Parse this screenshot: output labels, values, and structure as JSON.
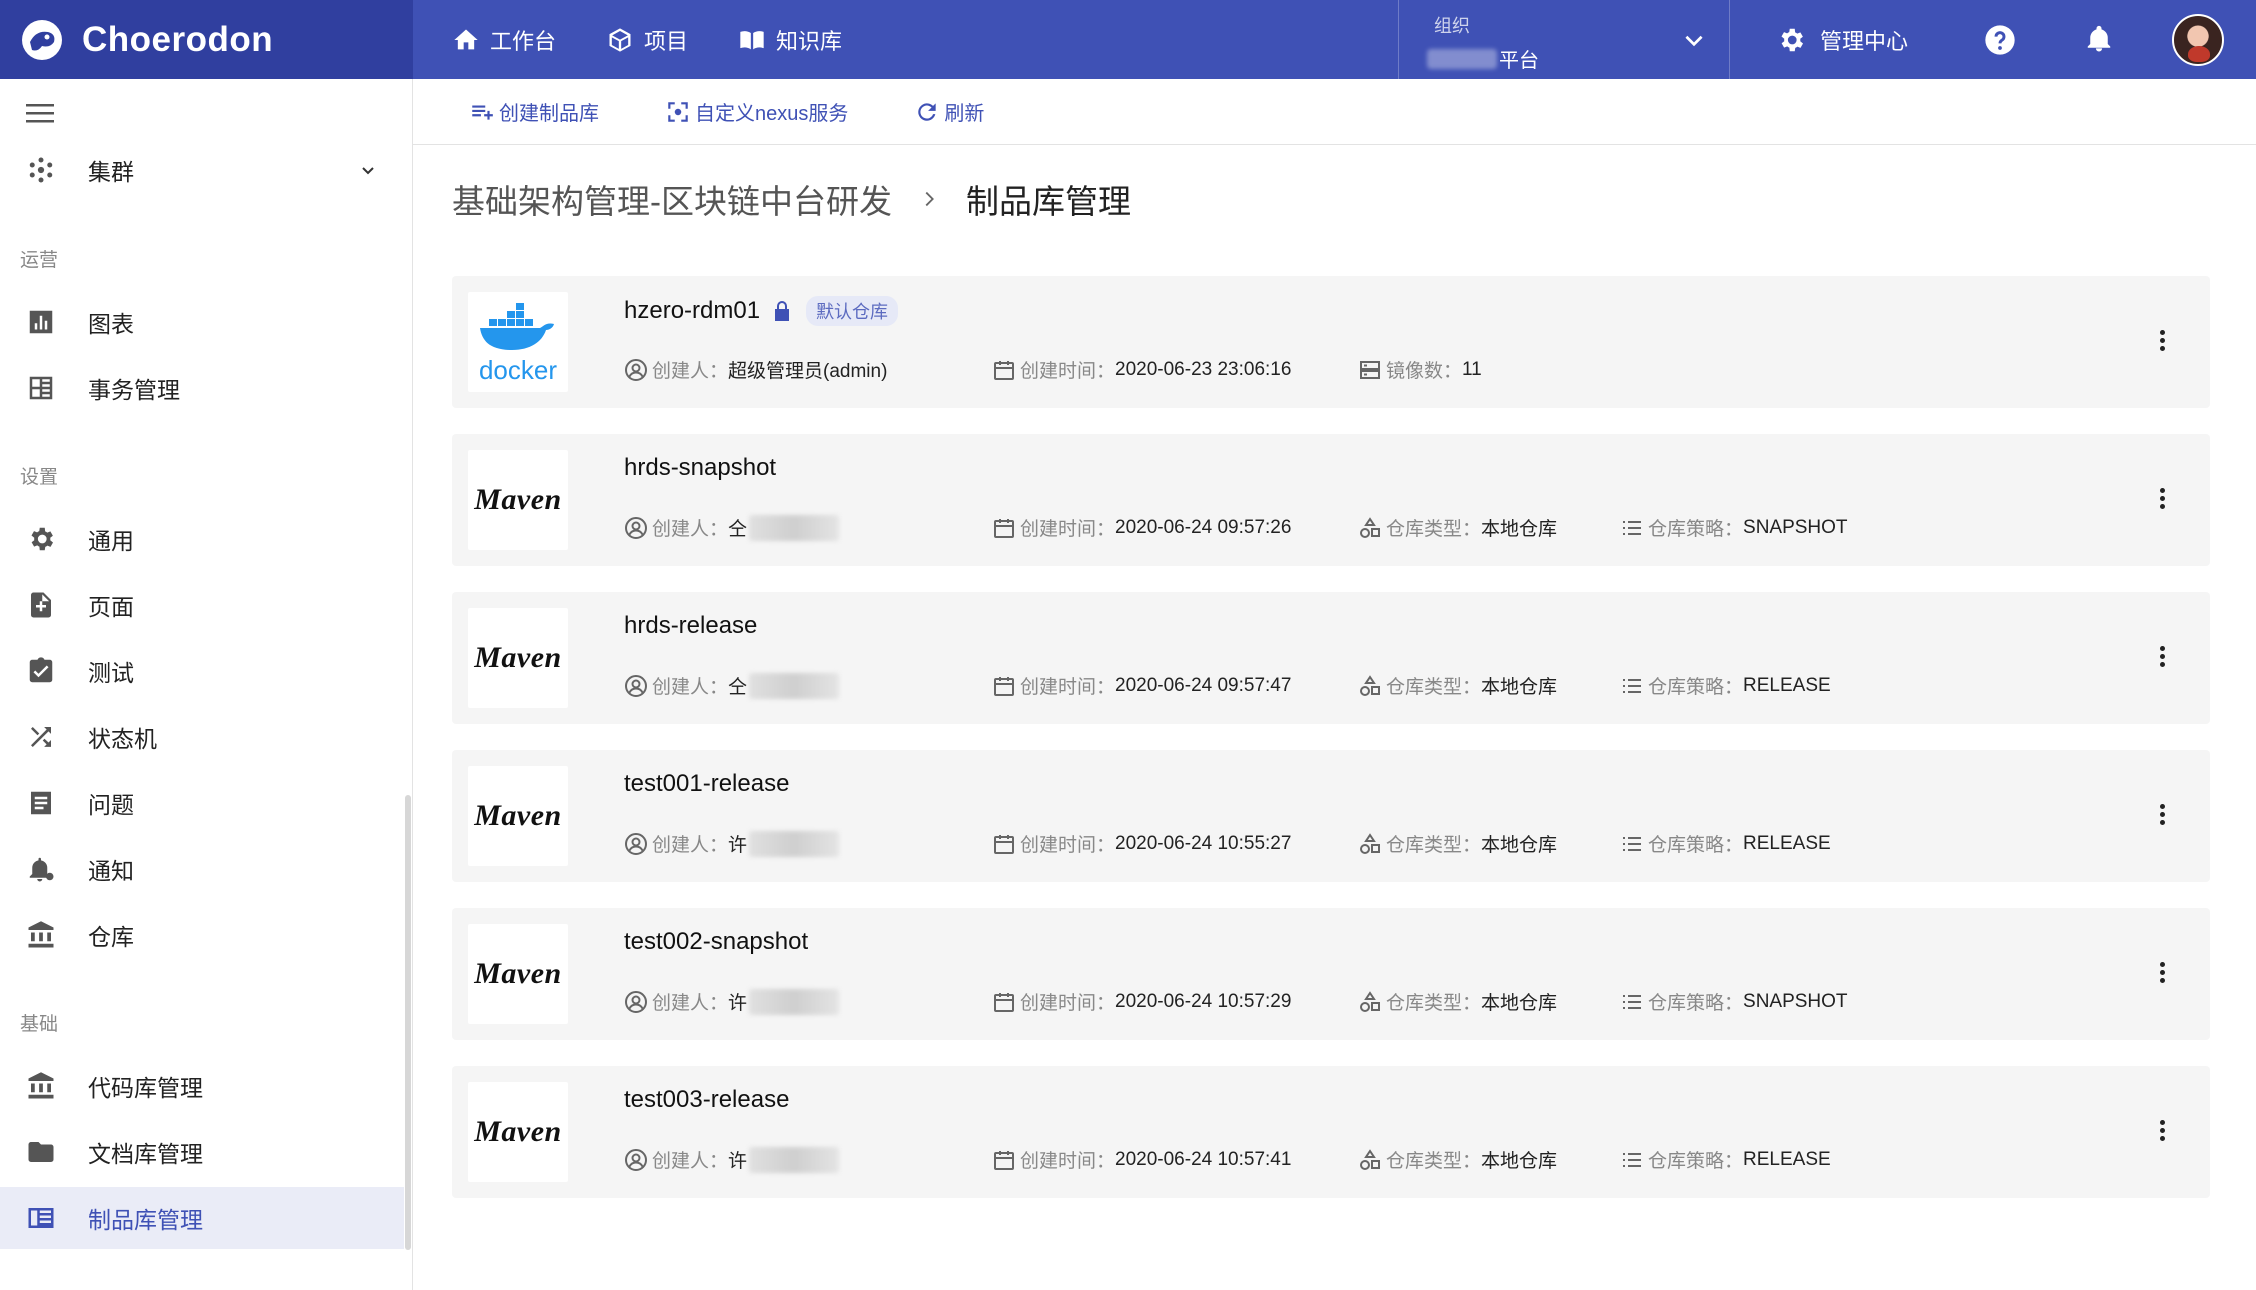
{
  "app": {
    "name": "Choerodon"
  },
  "top_nav": [
    {
      "label": "工作台",
      "icon": "home-icon"
    },
    {
      "label": "项目",
      "icon": "cube-icon"
    },
    {
      "label": "知识库",
      "icon": "book-icon"
    }
  ],
  "org": {
    "label": "组织",
    "value": "平台"
  },
  "header": {
    "admin_center": "管理中心"
  },
  "sidebar": {
    "cluster": "集群",
    "groups": {
      "ops": "运营",
      "settings": "设置",
      "basic": "基础"
    },
    "items": {
      "chart": "图表",
      "affairs": "事务管理",
      "general": "通用",
      "page": "页面",
      "test": "测试",
      "state_machine": "状态机",
      "issue": "问题",
      "notice": "通知",
      "warehouse": "仓库",
      "code_repo": "代码库管理",
      "doc_repo": "文档库管理",
      "artifact_repo": "制品库管理"
    }
  },
  "toolbar": {
    "create": "创建制品库",
    "custom_nexus": "自定义nexus服务",
    "refresh": "刷新"
  },
  "breadcrumb": {
    "parent": "基础架构管理-区块链中台研发",
    "current": "制品库管理"
  },
  "labels": {
    "creator": "创建人：",
    "created_time": "创建时间：",
    "image_count": "镜像数：",
    "repo_type": "仓库类型：",
    "repo_policy": "仓库策略："
  },
  "repos": [
    {
      "name": "hzero-rdm01",
      "badge": "默认仓库",
      "logo": "docker",
      "logo_text": "docker",
      "creator": "超级管理员(admin)",
      "created": "2020-06-23 23:06:16",
      "images": "11"
    },
    {
      "name": "hrds-snapshot",
      "logo": "maven",
      "logo_text": "Maven",
      "creator": "仝",
      "created": "2020-06-24 09:57:26",
      "type": "本地仓库",
      "policy": "SNAPSHOT"
    },
    {
      "name": "hrds-release",
      "logo": "maven",
      "logo_text": "Maven",
      "creator": "仝",
      "created": "2020-06-24 09:57:47",
      "type": "本地仓库",
      "policy": "RELEASE"
    },
    {
      "name": "test001-release",
      "logo": "maven",
      "logo_text": "Maven",
      "creator": "许",
      "created": "2020-06-24 10:55:27",
      "type": "本地仓库",
      "policy": "RELEASE"
    },
    {
      "name": "test002-snapshot",
      "logo": "maven",
      "logo_text": "Maven",
      "creator": "许",
      "created": "2020-06-24 10:57:29",
      "type": "本地仓库",
      "policy": "SNAPSHOT"
    },
    {
      "name": "test003-release",
      "logo": "maven",
      "logo_text": "Maven",
      "creator": "许",
      "created": "2020-06-24 10:57:41",
      "type": "本地仓库",
      "policy": "RELEASE"
    }
  ]
}
